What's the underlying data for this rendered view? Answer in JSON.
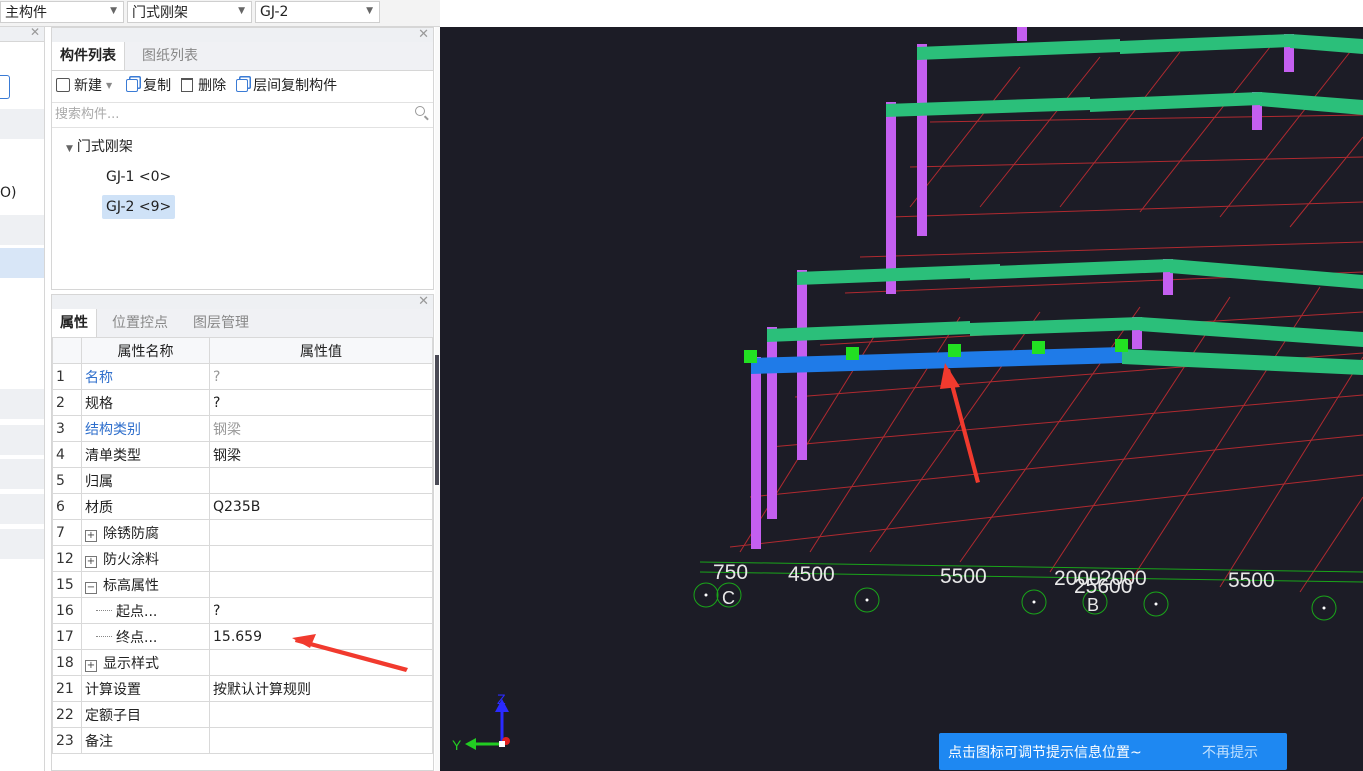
{
  "toolbar": {
    "combo1": "主构件",
    "combo2": "门式刚架",
    "combo3": "GJ-2"
  },
  "left_strip": {
    "fragment_text": "O)"
  },
  "component_panel": {
    "tabs": [
      "构件列表",
      "图纸列表"
    ],
    "tools": {
      "new": "新建",
      "copy": "复制",
      "delete": "删除",
      "floor_copy": "层间复制构件"
    },
    "search": {
      "placeholder": "搜索构件..."
    },
    "tree": {
      "root": "门式刚架",
      "items": [
        {
          "label": "GJ-1 <0>",
          "selected": false
        },
        {
          "label": "GJ-2 <9>",
          "selected": true
        }
      ]
    }
  },
  "property_panel": {
    "tabs": [
      "属性",
      "位置控点",
      "图层管理"
    ],
    "headers": {
      "name": "属性名称",
      "value": "属性值"
    },
    "rows": [
      {
        "num": "1",
        "name": "名称",
        "value": "?"
      },
      {
        "num": "2",
        "name": "规格",
        "value": "?"
      },
      {
        "num": "3",
        "name": "结构类别",
        "value": "钢梁"
      },
      {
        "num": "4",
        "name": "清单类型",
        "value": "钢梁"
      },
      {
        "num": "5",
        "name": "归属",
        "value": ""
      },
      {
        "num": "6",
        "name": "材质",
        "value": "Q235B"
      },
      {
        "num": "7",
        "name": "除锈防腐",
        "value": ""
      },
      {
        "num": "12",
        "name": "防火涂料",
        "value": ""
      },
      {
        "num": "15",
        "name": "标高属性",
        "value": ""
      },
      {
        "num": "16",
        "name": "起点...",
        "value": "?"
      },
      {
        "num": "17",
        "name": "终点...",
        "value": "15.659"
      },
      {
        "num": "18",
        "name": "显示样式",
        "value": ""
      },
      {
        "num": "21",
        "name": "计算设置",
        "value": "按默认计算规则"
      },
      {
        "num": "22",
        "name": "定额子目",
        "value": ""
      },
      {
        "num": "23",
        "name": "备注",
        "value": ""
      }
    ]
  },
  "viewport": {
    "dimension_labels": [
      "750",
      "4500",
      "5500",
      "2000",
      "2000",
      "25600",
      "5500"
    ],
    "axis_labels": [
      "C",
      "B"
    ],
    "axes": {
      "y": "Y",
      "z": "Z"
    }
  },
  "toast": {
    "message": "点击图标可调节提示信息位置~",
    "dismiss": "不再提示"
  },
  "colors": {
    "beam_green": "#2bbf7a",
    "column_purple": "#c45ff0",
    "selected_beam": "#1f7be8",
    "grid_red": "#b02a30",
    "axis_green": "#1aa51a",
    "toast_blue": "#1e88f2",
    "annotation_red": "#f13a2e"
  }
}
